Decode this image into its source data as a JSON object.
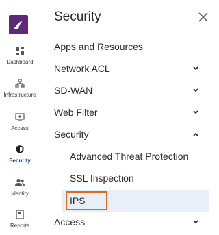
{
  "rail": {
    "items": [
      {
        "label": "Dashboard",
        "icon": "dashboard-icon"
      },
      {
        "label": "Infrastructure",
        "icon": "infrastructure-icon"
      },
      {
        "label": "Access",
        "icon": "access-icon"
      },
      {
        "label": "Security",
        "icon": "shield-icon"
      },
      {
        "label": "Identity",
        "icon": "identity-icon"
      },
      {
        "label": "Reports",
        "icon": "reports-icon"
      }
    ],
    "active": "Security"
  },
  "panel": {
    "title": "Security",
    "items": [
      {
        "label": "Apps and Resources"
      },
      {
        "label": "Network ACL"
      },
      {
        "label": "SD-WAN"
      },
      {
        "label": "Web Filter"
      },
      {
        "label": "Security"
      },
      {
        "label": "Access"
      }
    ],
    "security_subitems": [
      {
        "label": "Advanced Threat Protection"
      },
      {
        "label": "SSL Inspection"
      },
      {
        "label": "IPS"
      }
    ],
    "selected": "IPS"
  },
  "colors": {
    "brand": "#5e2a78",
    "highlight_border": "#e06a1b",
    "selected_bg": "#e8eff8",
    "active_label": "#1f3a8a"
  }
}
